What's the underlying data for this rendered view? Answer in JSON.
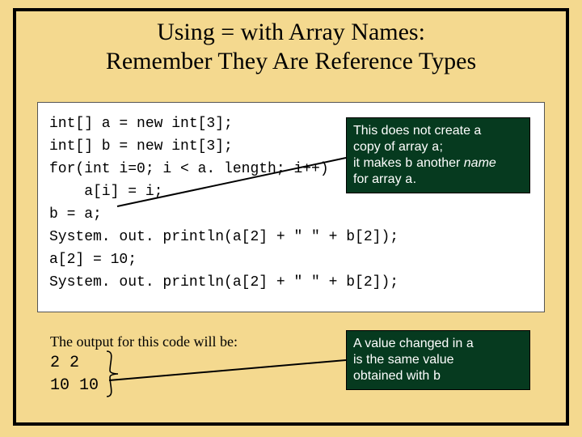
{
  "title": {
    "line1": "Using = with Array Names:",
    "line2": "Remember They Are Reference Types"
  },
  "code": {
    "l1": "int[] a = new int[3];",
    "l2": "int[] b = new int[3];",
    "l3": "for(int i=0; i < a. length; i++)",
    "l4": "    a[i] = i;",
    "l5": "b = a;",
    "l6": "System. out. println(a[2] + \" \" + b[2]);",
    "l7": "a[2] = 10;",
    "l8": "System. out. println(a[2] + \" \" + b[2]);"
  },
  "callout1": {
    "t1": "This does not create a",
    "t2a": "copy of array ",
    "t2b": "a",
    "t2c": ";",
    "t3a": "it makes ",
    "t3b": "b",
    "t3c": " another ",
    "t3d": "name",
    "t4a": "for array ",
    "t4b": "a",
    "t4c": "."
  },
  "callout2": {
    "t1a": "A value changed in ",
    "t1b": "a",
    "t2": "is the same value",
    "t3a": "obtained with ",
    "t3b": "b"
  },
  "output": {
    "label": "The output for this code will be:",
    "line1": "2 2",
    "line2": "10 10"
  }
}
